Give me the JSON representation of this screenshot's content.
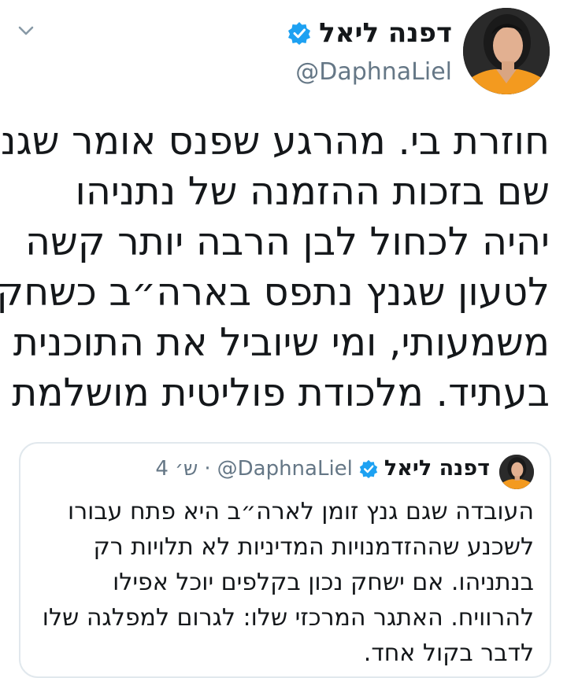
{
  "header": {
    "display_name": "דפנה ליאל",
    "handle": "@DaphnaLiel",
    "verified_icon": "verified-badge-icon",
    "menu_icon": "chevron-down-icon"
  },
  "tweet": {
    "lines": [
      "חוזרת בי. מהרגע שפנס אומר שגנץ",
      "שם בזכות ההזמנה של נתניהו",
      "יהיה לכחול לבן הרבה יותר קשה",
      "לטעון שגנץ נתפס בארה״ב כשחקן",
      "משמעותי, ומי שיוביל את התוכנית",
      "בעתיד. מלכודת פוליטית מושלמת"
    ]
  },
  "quoted_tweet": {
    "display_name": "דפנה ליאל",
    "handle": "@DaphnaLiel",
    "separator": "·",
    "time": "4 ש׳",
    "lines": [
      "העובדה שגם גנץ זומן לארה״ב היא פתח עבורו",
      "לשכנע שההזדמנויות המדיניות לא תלויות רק",
      "בנתניהו. אם ישחק נכון בקלפים יוכל אפילו",
      "להרוויח. האתגר המרכזי שלו: לגרום למפלגה שלו",
      "לדבר בקול אחד."
    ]
  },
  "colors": {
    "verified": "#1da1f2",
    "secondary_text": "#657786",
    "border": "#e1e8ed",
    "avatar_shirt": "#f39a1f"
  }
}
